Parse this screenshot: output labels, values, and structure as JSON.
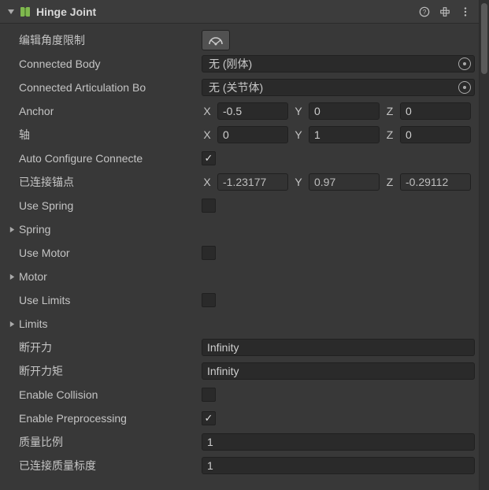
{
  "header": {
    "title": "Hinge Joint",
    "help_tooltip": "Help",
    "preset_tooltip": "Presets",
    "menu_tooltip": "Menu"
  },
  "fields": {
    "edit_angle_label": "编辑角度限制",
    "connected_body": {
      "label": "Connected Body",
      "value": "无 (刚体)"
    },
    "connected_articulation": {
      "label": "Connected Articulation Bo",
      "value": "无 (关节体)"
    },
    "anchor": {
      "label": "Anchor",
      "x": "-0.5",
      "y": "0",
      "z": "0"
    },
    "axis": {
      "label": "轴",
      "x": "0",
      "y": "1",
      "z": "0"
    },
    "auto_configure": {
      "label": "Auto Configure Connecte",
      "checked": true
    },
    "connected_anchor": {
      "label": "已连接锚点",
      "x": "-1.23177",
      "y": "0.97",
      "z": "-0.29112"
    },
    "use_spring": {
      "label": "Use Spring",
      "checked": false
    },
    "spring_header": "Spring",
    "use_motor": {
      "label": "Use Motor",
      "checked": false
    },
    "motor_header": "Motor",
    "use_limits": {
      "label": "Use Limits",
      "checked": false
    },
    "limits_header": "Limits",
    "break_force": {
      "label": "断开力",
      "value": "Infinity"
    },
    "break_torque": {
      "label": "断开力矩",
      "value": "Infinity"
    },
    "enable_collision": {
      "label": "Enable Collision",
      "checked": false
    },
    "enable_preprocessing": {
      "label": "Enable Preprocessing",
      "checked": true
    },
    "mass_scale": {
      "label": "质量比例",
      "value": "1"
    },
    "connected_mass_scale": {
      "label": "已连接质量标度",
      "value": "1"
    }
  },
  "axis_labels": {
    "x": "X",
    "y": "Y",
    "z": "Z"
  }
}
